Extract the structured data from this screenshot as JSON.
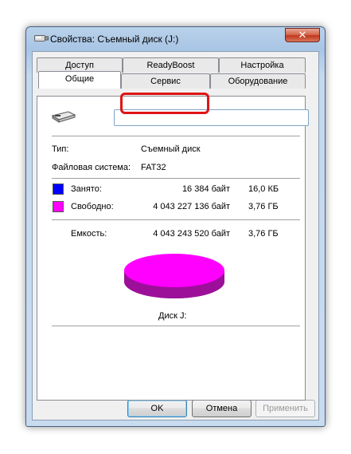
{
  "window": {
    "title": "Свойства: Съемный диск (J:)",
    "close_glyph": "✕"
  },
  "tabs": {
    "row1": [
      "Доступ",
      "ReadyBoost",
      "Настройка"
    ],
    "row2": [
      "Общие",
      "Сервис",
      "Оборудование"
    ],
    "active": "Общие",
    "highlighted": "Сервис"
  },
  "general": {
    "drive_name_value": "",
    "type_label": "Тип:",
    "type_value": "Съемный диск",
    "fs_label": "Файловая система:",
    "fs_value": "FAT32",
    "used_label": "Занято:",
    "used_bytes": "16 384 байт",
    "used_size": "16,0 КБ",
    "free_label": "Свободно:",
    "free_bytes": "4 043 227 136 байт",
    "free_size": "3,76 ГБ",
    "capacity_label": "Емкость:",
    "capacity_bytes": "4 043 243 520 байт",
    "capacity_size": "3,76 ГБ",
    "disk_label": "Диск J:"
  },
  "colors": {
    "used": "#0000ff",
    "free": "#ff00ff",
    "highlight": "#e01414"
  },
  "buttons": {
    "ok": "OK",
    "cancel": "Отмена",
    "apply": "Применить"
  },
  "icons": {
    "title": "usb-drive-icon",
    "drive": "usb-drive-icon",
    "close": "close-icon"
  }
}
